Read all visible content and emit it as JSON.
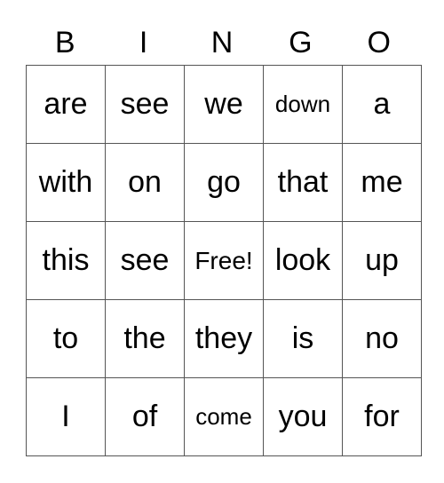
{
  "header": [
    "B",
    "I",
    "N",
    "G",
    "O"
  ],
  "rows": [
    [
      "are",
      "see",
      "we",
      "down",
      "a"
    ],
    [
      "with",
      "on",
      "go",
      "that",
      "me"
    ],
    [
      "this",
      "see",
      "Free!",
      "look",
      "up"
    ],
    [
      "to",
      "the",
      "they",
      "is",
      "no"
    ],
    [
      "I",
      "of",
      "come",
      "you",
      "for"
    ]
  ]
}
